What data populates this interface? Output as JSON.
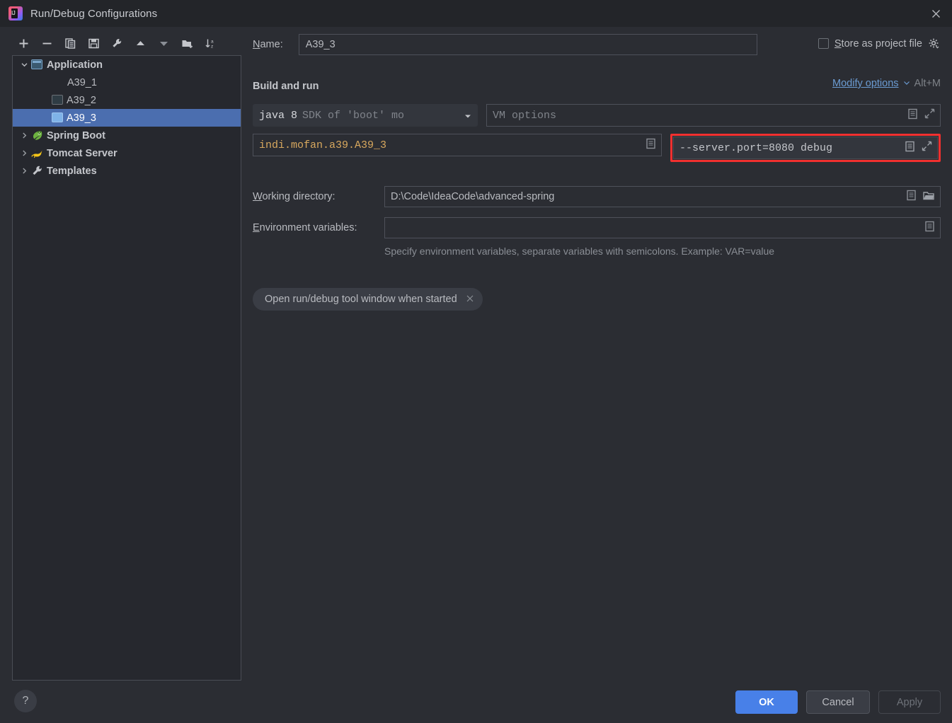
{
  "window": {
    "title": "Run/Debug Configurations",
    "app_icon": "intellij-idea-icon",
    "close_icon": "close-icon"
  },
  "toolbar": {
    "buttons": [
      {
        "name": "add-configuration-button",
        "icon": "plus-icon",
        "tooltip": "Add New Configuration"
      },
      {
        "name": "remove-configuration-button",
        "icon": "minus-icon",
        "tooltip": "Remove Configuration"
      },
      {
        "name": "copy-configuration-button",
        "icon": "copy-icon",
        "tooltip": "Copy Configuration"
      },
      {
        "name": "save-configuration-button",
        "icon": "save-icon",
        "tooltip": "Save Configuration"
      },
      {
        "name": "edit-templates-button",
        "icon": "wrench-icon",
        "tooltip": "Edit Templates"
      },
      {
        "name": "move-up-button",
        "icon": "arrow-up-icon",
        "tooltip": "Move Up"
      },
      {
        "name": "move-down-button",
        "icon": "arrow-down-icon",
        "tooltip": "Move Down"
      },
      {
        "name": "new-folder-button",
        "icon": "new-folder-icon",
        "tooltip": "Create New Folder"
      },
      {
        "name": "sort-button",
        "icon": "sort-alphabetical-icon",
        "tooltip": "Sort Configurations"
      }
    ]
  },
  "tree": {
    "items": [
      {
        "label": "Application",
        "icon": "application-icon",
        "expanded": true,
        "level": 0,
        "bold": true,
        "selected": false
      },
      {
        "label": "A39_1",
        "icon": "none",
        "level": 1,
        "selected": false
      },
      {
        "label": "A39_2",
        "icon": "application-config-icon",
        "level": 1,
        "selected": false
      },
      {
        "label": "A39_3",
        "icon": "application-config-selected-icon",
        "level": 1,
        "selected": true
      },
      {
        "label": "Spring Boot",
        "icon": "spring-boot-icon",
        "expanded": false,
        "level": 0,
        "bold": true,
        "selected": false
      },
      {
        "label": "Tomcat Server",
        "icon": "tomcat-icon",
        "expanded": false,
        "level": 0,
        "bold": true,
        "selected": false
      },
      {
        "label": "Templates",
        "icon": "wrench-icon",
        "expanded": false,
        "level": 0,
        "bold": true,
        "selected": false
      }
    ]
  },
  "form": {
    "name_label": "Name:",
    "name_label_mnemonic": "N",
    "name_value": "A39_3",
    "store_as_project_file": {
      "label": "Store as project file",
      "mnemonic": "S",
      "checked": false,
      "gear_icon": "gear-icon"
    },
    "section": {
      "title": "Build and run",
      "modify_options_label": "Modify options",
      "modify_options_shortcut": "Alt+M",
      "chevron_icon": "chevron-down-icon"
    },
    "jdk": {
      "main": "java 8",
      "sub": "SDK of 'boot' mo",
      "arrow_icon": "dropdown-arrow-icon"
    },
    "vm_options": {
      "placeholder": "VM options",
      "value": "",
      "macro_icon": "macro-list-icon",
      "expand_icon": "expand-icon"
    },
    "main_class": {
      "value": "indi.mofan.a39.A39_3",
      "browse_icon": "macro-list-icon"
    },
    "program_arguments": {
      "value": "--server.port=8080 debug",
      "macro_icon": "macro-list-icon",
      "expand_icon": "expand-icon",
      "highlighted": true,
      "highlight_color": "#f2302f"
    },
    "working_directory": {
      "label": "Working directory:",
      "mnemonic": "W",
      "value": "D:\\Code\\IdeaCode\\advanced-spring",
      "macro_icon": "macro-list-icon",
      "browse_icon": "folder-open-icon"
    },
    "environment_variables": {
      "label": "Environment variables:",
      "mnemonic": "E",
      "value": "",
      "macro_icon": "macro-list-icon",
      "hint": "Specify environment variables, separate variables with semicolons. Example: VAR=value"
    },
    "chips": [
      {
        "label": "Open run/debug tool window when started",
        "close_icon": "close-small-icon"
      }
    ]
  },
  "footer": {
    "help_label": "?",
    "help_icon": "help-icon",
    "ok_label": "OK",
    "cancel_label": "Cancel",
    "apply_label": "Apply"
  },
  "colors": {
    "accent": "#4880e8",
    "selection": "#4b6eaf",
    "highlight": "#f2302f",
    "link": "#6b9bd2",
    "code": "#d8a85e",
    "background": "#2b2d33",
    "titlebar": "#232529",
    "panel": "#26282e"
  }
}
